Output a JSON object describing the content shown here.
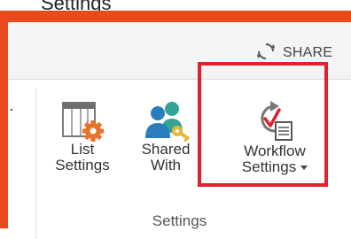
{
  "top_caption": "Settings",
  "share": {
    "label": "SHARE",
    "icon": "share-sync-icon"
  },
  "ribbon": {
    "group_label": "Settings",
    "buttons": [
      {
        "line1": "List",
        "line2": "Settings",
        "icon": "list-settings-gear-icon"
      },
      {
        "line1": "Shared",
        "line2": "With",
        "icon": "shared-with-users-key-icon"
      },
      {
        "line1": "Workflow",
        "line2": "Settings",
        "icon": "workflow-settings-icon",
        "has_dropdown": true
      }
    ]
  },
  "colors": {
    "frame_orange": "#e8491d",
    "highlight_red": "#e0202e",
    "topbar_bg": "#f3f4f5",
    "gear_orange": "#e8722a",
    "user_blue": "#2a7dbd",
    "user_teal": "#33a398",
    "key_gold": "#e7b73b"
  }
}
